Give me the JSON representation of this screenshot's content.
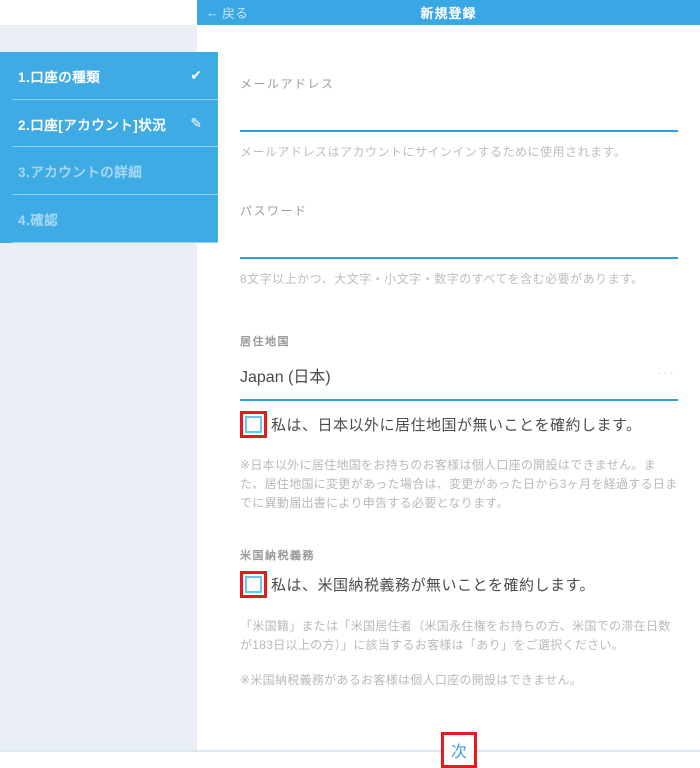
{
  "header": {
    "back_label": "戻る",
    "back_arrow": "←",
    "title": "新規登録"
  },
  "sidebar": {
    "items": [
      {
        "label": "1.口座の種類",
        "icon": "check-icon",
        "state": "done"
      },
      {
        "label": "2.口座[アカウント]状況",
        "icon": "pencil-icon",
        "state": "current"
      },
      {
        "label": "3.アカウントの詳細",
        "icon": "",
        "state": "upcoming"
      },
      {
        "label": "4.確認",
        "icon": "",
        "state": "upcoming"
      }
    ]
  },
  "form": {
    "email": {
      "label": "メールアドレス",
      "value": "",
      "helper": "メールアドレスはアカウントにサインインするために使用されます。"
    },
    "password": {
      "label": "パスワード",
      "value": "",
      "helper": "8文字以上かつ、大文字・小文字・数字のすべてを含む必要があります。"
    },
    "residence": {
      "label": "居住地国",
      "value": "Japan (日本)",
      "menu_dots": "···",
      "checkbox_checked": false,
      "checkbox_label": "私は、日本以外に居住地国が無いことを確約します。",
      "note": "※日本以外に居住地国をお持ちのお客様は個人口座の開設はできません。また、居住地国に変更があった場合は、変更があった日から3ヶ月を経過する日までに異動届出書により申告する必要となります。"
    },
    "us_tax": {
      "label": "米国納税義務",
      "checkbox_checked": false,
      "checkbox_label": "私は、米国納税義務が無いことを確約します。",
      "note1": "「米国籍」または「米国居住者（米国永住権をお持ちの方、米国での滞在日数が183日以上の方）」に該当するお客様は「あり」をご選択ください。",
      "note2": "※米国納税義務があるお客様は個人口座の開設はできません。"
    },
    "next_label": "次"
  },
  "colors": {
    "accent_blue": "#38a7e4",
    "underline_blue": "#2f9fe3",
    "annotation_red": "#e8181f",
    "rail_gray": "#e8eef4",
    "label_gray": "#9d9d9d",
    "note_gray": "#b9b9b9",
    "text_dark": "#4a4a4a"
  },
  "icons": {
    "check": "✔",
    "pencil": "✎"
  }
}
